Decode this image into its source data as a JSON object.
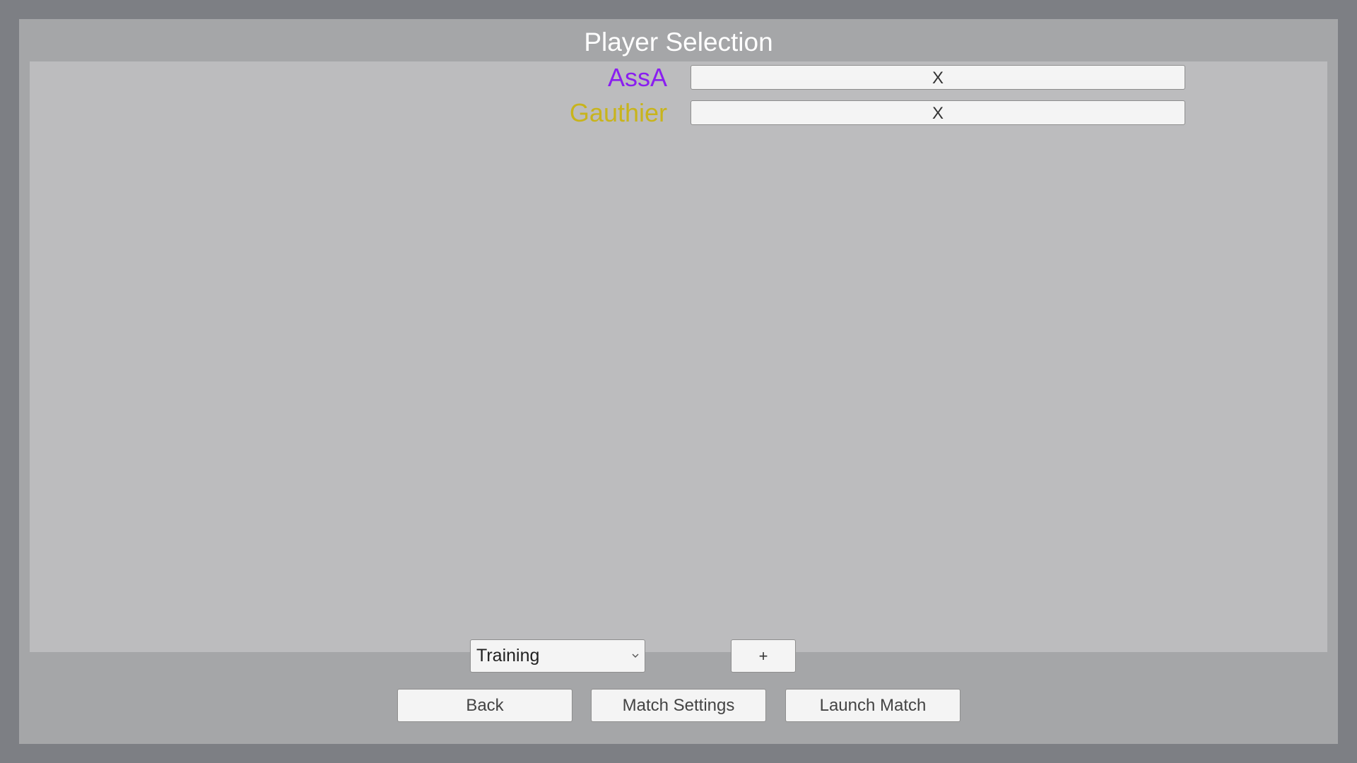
{
  "title": "Player Selection",
  "players": [
    {
      "name": "AssA",
      "color": "#8a1ef0",
      "remove_label": "X"
    },
    {
      "name": "Gauthier",
      "color": "#c8b41c",
      "remove_label": "X"
    }
  ],
  "controls": {
    "player_type_selected": "Training",
    "dropdown_arrow_icon": "chevron-down-icon",
    "add_label": "+"
  },
  "footer": {
    "back_label": "Back",
    "match_settings_label": "Match Settings",
    "launch_match_label": "Launch Match"
  }
}
